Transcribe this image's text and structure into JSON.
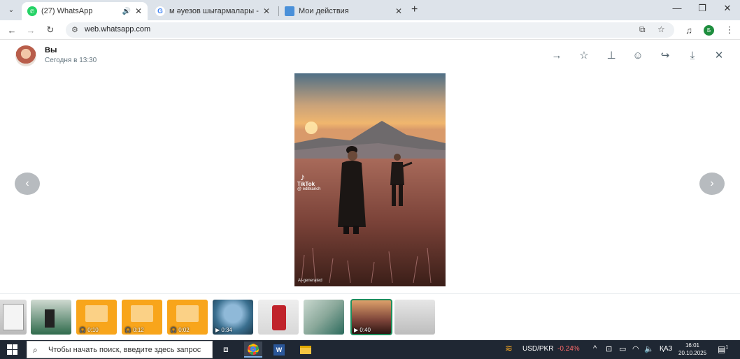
{
  "browser": {
    "tabs": [
      {
        "title": "(27) WhatsApp",
        "favicon": "whatsapp-icon",
        "active": true,
        "audio": true
      },
      {
        "title": "м әуезов шығармалары - Пои",
        "favicon": "google-icon",
        "active": false
      },
      {
        "title": "Мои действия",
        "favicon": "activity-icon",
        "active": false
      }
    ],
    "url": "web.whatsapp.com",
    "profile_initial": "Б"
  },
  "viewer": {
    "sender": "Вы",
    "timestamp": "Сегодня в 13:30",
    "media_watermark": "TikTok",
    "media_handle": "@ editkarich",
    "media_footer": "AI-generated"
  },
  "thumbnails": [
    {
      "kind": "image",
      "caption": ""
    },
    {
      "kind": "image",
      "caption": ""
    },
    {
      "kind": "audio",
      "caption": "0:10"
    },
    {
      "kind": "audio",
      "caption": "0:12"
    },
    {
      "kind": "audio",
      "caption": "0:02"
    },
    {
      "kind": "video",
      "caption": "0:34"
    },
    {
      "kind": "image",
      "caption": ""
    },
    {
      "kind": "image",
      "caption": ""
    },
    {
      "kind": "video",
      "caption": "0:40",
      "selected": true
    },
    {
      "kind": "image",
      "caption": ""
    }
  ],
  "taskbar": {
    "search_placeholder": "Чтобы начать поиск, введите здесь запрос",
    "ticker_label": "USD/PKR",
    "ticker_change": "-0.24%",
    "language": "ҚАЗ",
    "time": "16:01",
    "date": "20.10.2025",
    "notifications": "1"
  },
  "colors": {
    "accent_green": "#1e8e5e",
    "ticker_negative": "#ff6b6b",
    "audio_thumb": "#f8a51b"
  }
}
